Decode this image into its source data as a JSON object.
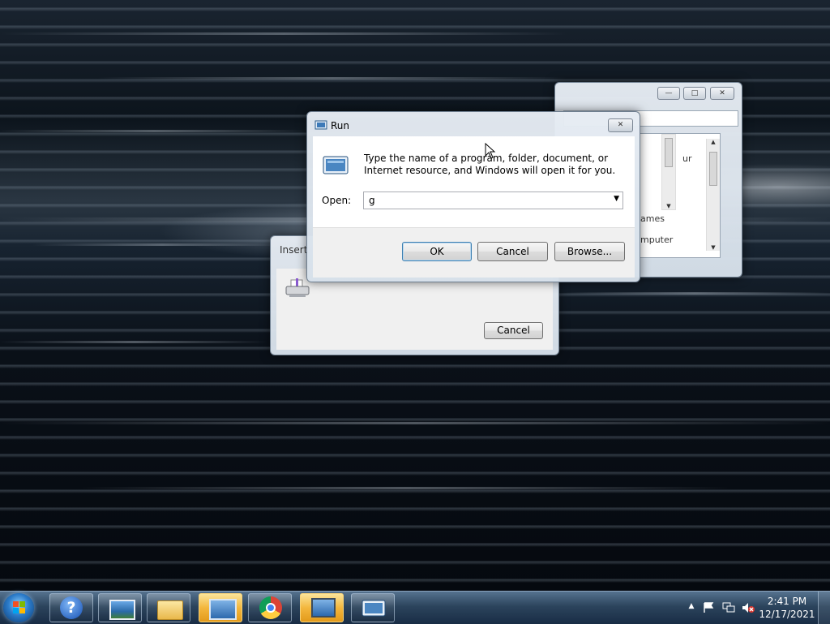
{
  "run": {
    "title": "Run",
    "description": "Type the name of a program, folder, document, or Internet resource, and Windows will open it for you.",
    "open_label": "Open:",
    "open_value": "g",
    "ok": "OK",
    "cancel": "Cancel",
    "browse": "Browse..."
  },
  "insert_dialog": {
    "title": "Insert",
    "cancel": "Cancel"
  },
  "back_window": {
    "partial_texts": [
      "ur",
      "ames",
      "mputer"
    ]
  },
  "taskbar": {
    "pinned": [
      {
        "name": "help-and-support-icon"
      },
      {
        "name": "photo-viewer-icon"
      },
      {
        "name": "file-explorer-icon"
      },
      {
        "name": "control-panel-icon"
      },
      {
        "name": "chrome-icon"
      },
      {
        "name": "remote-desktop-icon"
      },
      {
        "name": "run-icon"
      }
    ],
    "clock_time": "2:41 PM",
    "clock_date": "12/17/2021"
  },
  "colors": {
    "accent": "#3c7fb1",
    "taskbar": "#2d4660",
    "active_task": "#f3b73e"
  }
}
